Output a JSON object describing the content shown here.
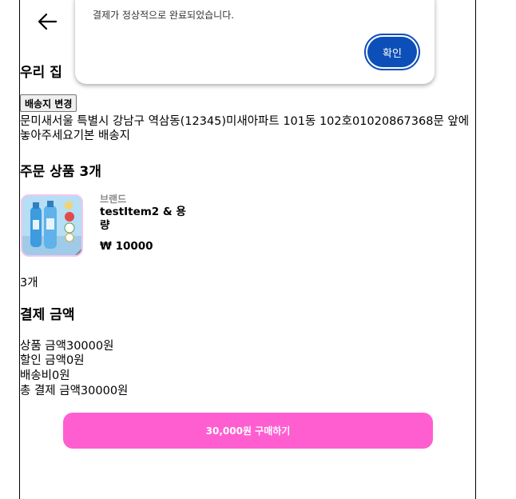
{
  "header": {
    "back_icon": "arrow-left-icon"
  },
  "address": {
    "title": "우리 집",
    "change_button": "배송지 변경",
    "detail": "문미새서울 특별시 강남구 역삼동(12345)미새아파트 101동 102호01020867368문 앞에 놓아주세요기본 배송지"
  },
  "order": {
    "title": "주문 상품 3개",
    "item": {
      "brand": "브랜드",
      "name": "testItem2 & 용량",
      "price": "₩ 10000",
      "quantity": "3개"
    }
  },
  "payment": {
    "title": "결제 금액",
    "rows": [
      "상품 금액30000원",
      "할인 금액0원",
      "배송비0원",
      "총 결제 금액30000원"
    ]
  },
  "buy_button": "30,000원 구매하기",
  "dialog": {
    "message": "결제가 정상적으로 완료되었습니다.",
    "ok_label": "확인"
  },
  "colors": {
    "accent_pink": "#ff5ed1",
    "dialog_button": "#0c4fb8"
  }
}
